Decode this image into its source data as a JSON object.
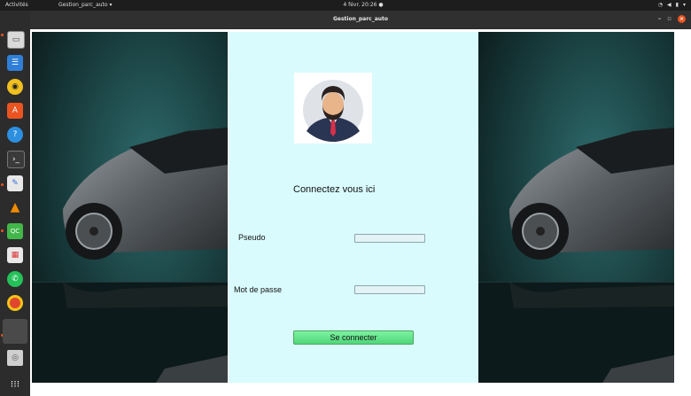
{
  "topbar": {
    "activities": "Activités",
    "app_menu": "Gestion_parc_auto ▾",
    "clock": "4 févr. 20:26 ●",
    "tray_icons": [
      "accessibility-icon",
      "volume-icon",
      "battery-icon",
      "system-menu-icon"
    ]
  },
  "window": {
    "title": "Gestion_parc_auto",
    "minimize": "–",
    "maximize": "▫",
    "close": "×"
  },
  "dock": {
    "apps": [
      "files-icon",
      "writer-icon",
      "rhythmbox-icon",
      "app-center-icon",
      "help-icon",
      "terminal-icon",
      "text-editor-icon",
      "vlc-icon",
      "qt-creator-icon",
      "image-viewer-icon",
      "whatsapp-icon",
      "chrome-icon",
      "active-window-icon",
      "trash-icon",
      "show-apps-icon"
    ]
  },
  "login": {
    "heading": "Connectez vous ici",
    "username_label": "Pseudo",
    "password_label": "Mot de passe",
    "username_value": "",
    "password_value": "",
    "submit_label": "Se connecter"
  },
  "colors": {
    "form_background": "#d9fbfd",
    "button": "#5ee08a",
    "accent": "#e95420"
  }
}
